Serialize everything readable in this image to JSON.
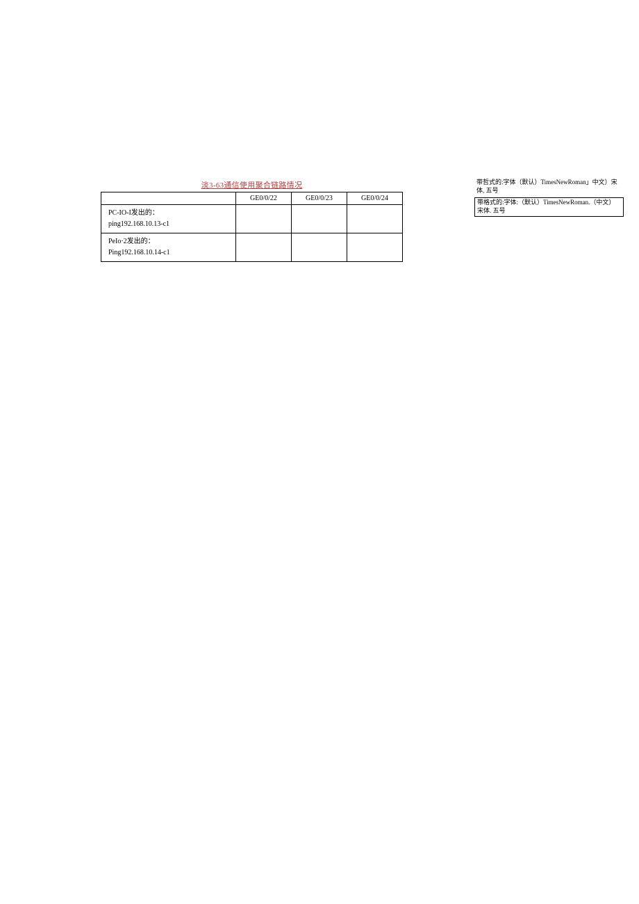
{
  "title": "淡3-63通信使用聚合链路情况",
  "table": {
    "headers": [
      "",
      "GE0/0/22",
      "GE0/0/23",
      "GE0/0/24"
    ],
    "rows": [
      {
        "label_line1": "PC-IO-I发出的：",
        "label_line2": "ping192.168.10.13-c1"
      },
      {
        "label_line1": "PeIo·2发出的：",
        "label_line2": "Ping192.168.10.14-c1"
      }
    ]
  },
  "annotations": [
    {
      "text": "带哲式的:字体（默认）TimesNewRoman」中文）宋体, 五号",
      "boxed": false
    },
    {
      "text": "带格式的:字体:（默认）TimesNewRoman.（中文）宋体. 五号",
      "boxed": true
    }
  ]
}
